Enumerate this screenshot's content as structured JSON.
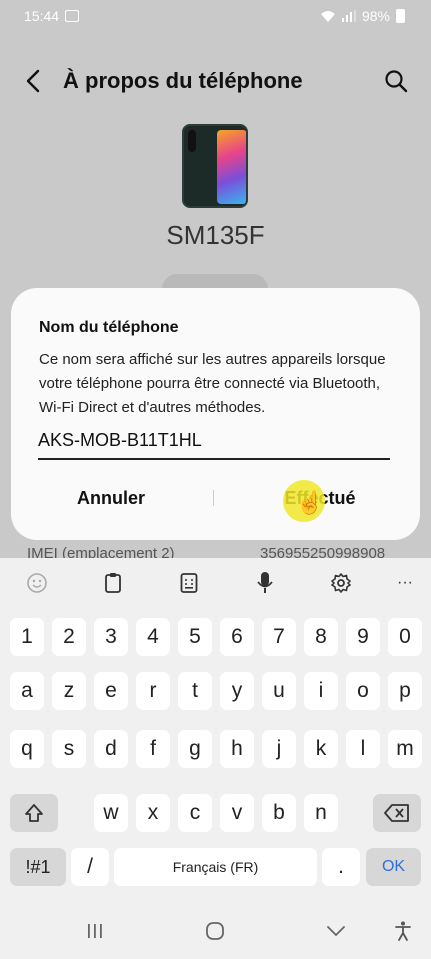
{
  "status_bar": {
    "time": "15:44",
    "battery": "98%"
  },
  "header": {
    "title": "À propos du téléphone"
  },
  "device": {
    "model": "SM135F"
  },
  "dialog": {
    "title": "Nom du téléphone",
    "description": "Ce nom sera affiché sur les autres appareils lorsque votre téléphone pourra être connecté via Bluetooth, Wi-Fi Direct et d'autres méthodes.",
    "input_value": "AKS-MOB-B11T1HL",
    "cancel_label": "Annuler",
    "done_label": "Effectué"
  },
  "background_row": {
    "label": "IMEI (emplacement 2)",
    "value": "356955250998908"
  },
  "keyboard": {
    "row_numbers": [
      "1",
      "2",
      "3",
      "4",
      "5",
      "6",
      "7",
      "8",
      "9",
      "0"
    ],
    "row1": [
      "a",
      "z",
      "e",
      "r",
      "t",
      "y",
      "u",
      "i",
      "o",
      "p"
    ],
    "row2": [
      "q",
      "s",
      "d",
      "f",
      "g",
      "h",
      "j",
      "k",
      "l",
      "m"
    ],
    "row3": [
      "w",
      "x",
      "c",
      "v",
      "b",
      "n"
    ],
    "symbols_label": "!#1",
    "slash_label": "/",
    "space_label": "Français (FR)",
    "period_label": ".",
    "ok_label": "OK",
    "more_label": "···"
  }
}
